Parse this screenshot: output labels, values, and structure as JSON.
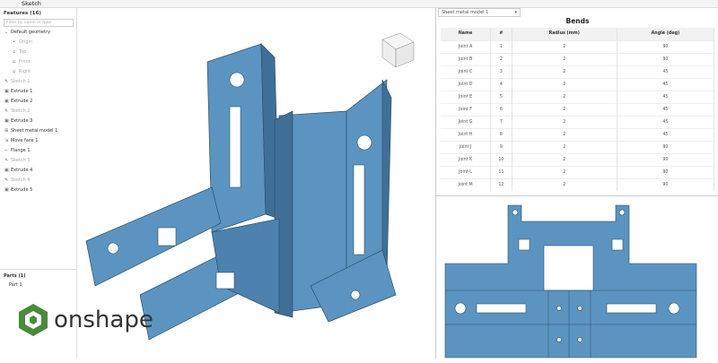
{
  "toolbar": {
    "sketch_label": "Sketch"
  },
  "features": {
    "title": "Features (16)",
    "filter_placeholder": "Filter by name or type",
    "items": [
      {
        "label": "Default geometry",
        "icon": "chevron-down-icon",
        "dim": false,
        "indent": false
      },
      {
        "label": "Origin",
        "icon": "origin-icon",
        "dim": true,
        "indent": true
      },
      {
        "label": "Top",
        "icon": "plane-icon",
        "dim": true,
        "indent": true
      },
      {
        "label": "Front",
        "icon": "plane-icon",
        "dim": true,
        "indent": true
      },
      {
        "label": "Right",
        "icon": "plane-icon",
        "dim": true,
        "indent": true
      },
      {
        "label": "Sketch 1",
        "icon": "sketch-icon",
        "dim": true,
        "indent": false
      },
      {
        "label": "Extrude 1",
        "icon": "extrude-icon",
        "dim": false,
        "indent": false
      },
      {
        "label": "Extrude 2",
        "icon": "extrude-icon",
        "dim": false,
        "indent": false
      },
      {
        "label": "Sketch 2",
        "icon": "sketch-icon",
        "dim": true,
        "indent": false
      },
      {
        "label": "Extrude 3",
        "icon": "extrude-icon",
        "dim": false,
        "indent": false
      },
      {
        "label": "Sheet metal model 1",
        "icon": "sheet-metal-icon",
        "dim": false,
        "indent": false
      },
      {
        "label": "Move face 1",
        "icon": "move-face-icon",
        "dim": false,
        "indent": false
      },
      {
        "label": "Flange 1",
        "icon": "flange-icon",
        "dim": false,
        "indent": false
      },
      {
        "label": "Sketch 3",
        "icon": "sketch-icon",
        "dim": true,
        "indent": false
      },
      {
        "label": "Extrude 4",
        "icon": "extrude-icon",
        "dim": false,
        "indent": false
      },
      {
        "label": "Sketch 4",
        "icon": "sketch-icon",
        "dim": true,
        "indent": false
      },
      {
        "label": "Extrude 5",
        "icon": "extrude-icon",
        "dim": false,
        "indent": false
      }
    ]
  },
  "parts": {
    "title": "Parts (1)",
    "items": [
      "Part 1"
    ]
  },
  "bends": {
    "selected_model": "Sheet metal model 1",
    "title": "Bends",
    "columns": [
      "Name",
      "#",
      "Radius (mm)",
      "Angle (deg)"
    ],
    "rows": [
      [
        "Joint A",
        "1",
        "2",
        "90"
      ],
      [
        "Joint B",
        "2",
        "2",
        "90"
      ],
      [
        "Joint C",
        "3",
        "2",
        "45"
      ],
      [
        "Joint D",
        "4",
        "2",
        "45"
      ],
      [
        "Joint E",
        "5",
        "2",
        "45"
      ],
      [
        "Joint F",
        "6",
        "2",
        "45"
      ],
      [
        "Joint G",
        "7",
        "2",
        "45"
      ],
      [
        "Joint H",
        "8",
        "2",
        "45"
      ],
      [
        "Joint J",
        "9",
        "2",
        "90"
      ],
      [
        "Joint K",
        "10",
        "2",
        "90"
      ],
      [
        "Joint L",
        "11",
        "2",
        "90"
      ],
      [
        "Joint M",
        "12",
        "2",
        "90"
      ]
    ]
  },
  "logo": {
    "text": "onshape"
  },
  "colors": {
    "part": "#5b94c0",
    "part_dark": "#3f6f97",
    "logo_green": "#4a8a3c"
  }
}
